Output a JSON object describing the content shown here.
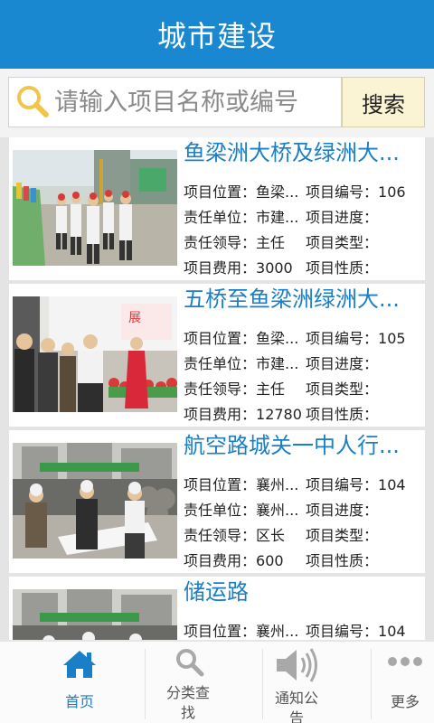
{
  "header": {
    "title": "城市建设"
  },
  "search": {
    "placeholder": "请输入项目名称或编号",
    "button_label": "搜索"
  },
  "labels": {
    "location": "项目位置：",
    "code": "项目编号：",
    "unit": "责任单位：",
    "progress": "项目进度：",
    "leader": "责任领导：",
    "type": "项目类型：",
    "cost": "项目费用：",
    "nature": "项目性质："
  },
  "projects": [
    {
      "title": "鱼梁洲大桥及绿洲大...",
      "location": "鱼梁...",
      "code": "106",
      "unit": "市建...",
      "progress": "",
      "leader": "主任",
      "type": "",
      "cost": "3000",
      "nature": ""
    },
    {
      "title": "五桥至鱼梁洲绿洲大...",
      "location": "鱼梁...",
      "code": "105",
      "unit": "市建...",
      "progress": "",
      "leader": "主任",
      "type": "",
      "cost": "12780",
      "nature": ""
    },
    {
      "title": "航空路城关一中人行...",
      "location": "襄州...",
      "code": "104",
      "unit": "襄州...",
      "progress": "",
      "leader": "区长",
      "type": "",
      "cost": "600",
      "nature": ""
    },
    {
      "title": "储运路",
      "location": "襄州...",
      "code": "104"
    }
  ],
  "nav": {
    "home": "首页",
    "category": "分类查\n找",
    "notice": "通知公\n告",
    "more": "更多"
  },
  "colors": {
    "header": "#1a88d0",
    "title_text": "#1b7fc7",
    "search_button": "#fbf4d4"
  }
}
